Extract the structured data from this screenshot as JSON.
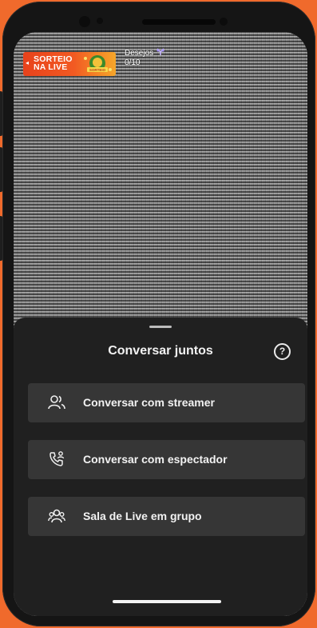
{
  "promo": {
    "line1": "SORTEIO",
    "line2": "NA LIVE",
    "arrow": "◂",
    "art_label": "SORTEIO"
  },
  "wishlist": {
    "label": "Desejos",
    "count": "0/10",
    "icon": "gift-icon"
  },
  "sheet": {
    "title": "Conversar juntos",
    "help_label": "?",
    "options": [
      {
        "label": "Conversar com streamer",
        "icon": "people-icon"
      },
      {
        "label": "Conversar com espectador",
        "icon": "phone-person-icon"
      },
      {
        "label": "Sala de Live em grupo",
        "icon": "group-icon"
      }
    ]
  },
  "colors": {
    "frame_bg": "#f06a2c",
    "sheet_bg": "#202020",
    "option_bg": "#363636",
    "text": "#f2f2f2"
  }
}
